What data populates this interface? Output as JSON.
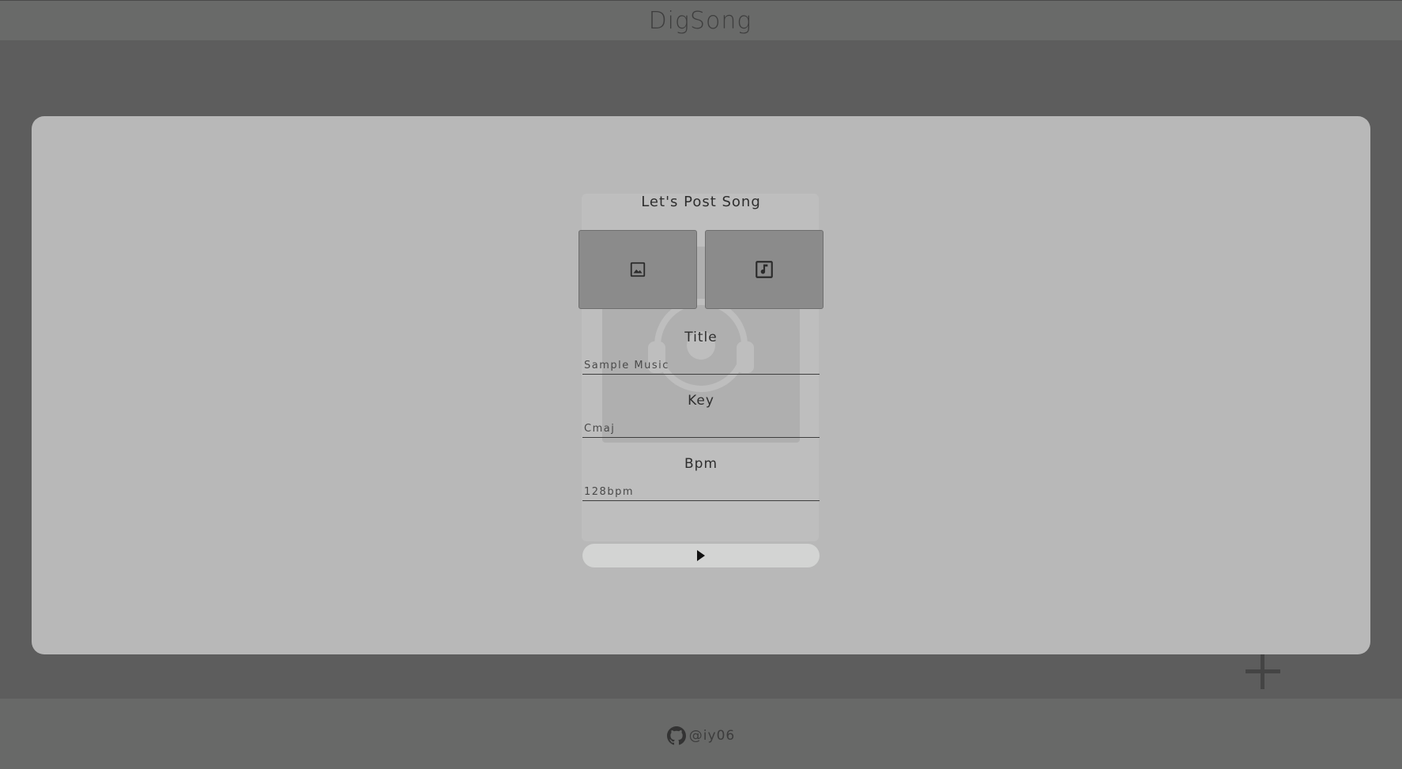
{
  "header": {
    "brand": "DigSong"
  },
  "modal": {
    "title": "Let's Post Song",
    "upload_image_icon": "image-icon",
    "upload_music_icon": "music-note-icon",
    "fields": [
      {
        "label": "Title",
        "placeholder": "Sample Music"
      },
      {
        "label": "Key",
        "placeholder": "Cmaj"
      },
      {
        "label": "Bpm",
        "placeholder": "128bpm"
      }
    ],
    "submit_icon": "play-icon"
  },
  "fab": {
    "icon": "plus-icon"
  },
  "footer": {
    "icon": "github-icon",
    "handle": "@iy06"
  }
}
